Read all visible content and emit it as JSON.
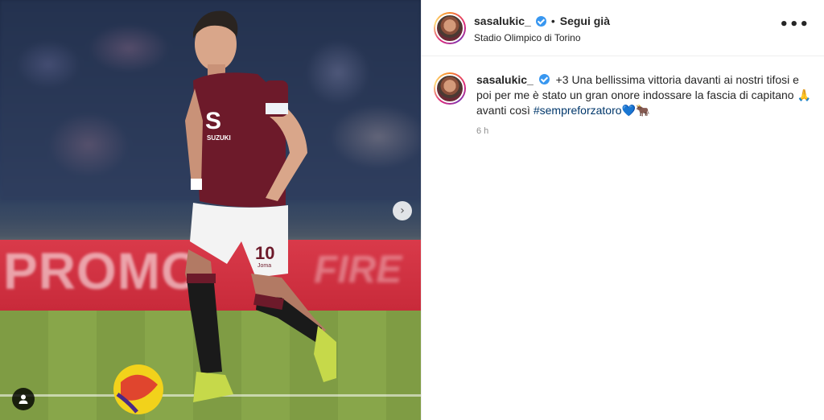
{
  "post": {
    "username": "sasalukic_",
    "follow_separator": "•",
    "follow_label": "Segui già",
    "location": "Stadio Olimpico di Torino",
    "more_label": "•••",
    "caption_part1": "+3 Una bellissima vittoria davanti ai nostri tifosi e poi per me è stato un gran onore indossare la fascia di capitano 🙏 avanti così ",
    "hashtag": "#sempreforzatoro",
    "caption_end": "💙🐂",
    "timestamp": "6 h"
  },
  "photo": {
    "board_text": "PROMO",
    "board_text_right": "FIRE",
    "jersey_number": "10",
    "jersey_brand": "Joma",
    "sponsor": "SUZUKI",
    "next_icon": "›"
  }
}
